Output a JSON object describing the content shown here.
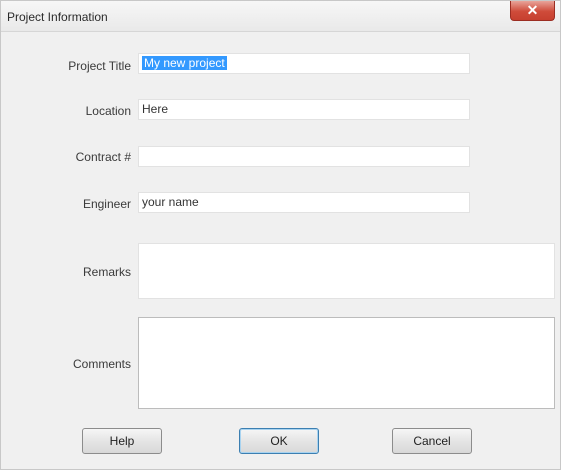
{
  "window": {
    "title": "Project Information",
    "close_glyph": "✕"
  },
  "form": {
    "project_title": {
      "label": "Project Title",
      "value": "My new project"
    },
    "location": {
      "label": "Location",
      "value": "Here"
    },
    "contract": {
      "label": "Contract #",
      "value": ""
    },
    "engineer": {
      "label": "Engineer",
      "value": "your name"
    },
    "remarks": {
      "label": "Remarks",
      "value": ""
    },
    "comments": {
      "label": "Comments",
      "value": ""
    }
  },
  "buttons": {
    "help": "Help",
    "ok": "OK",
    "cancel": "Cancel"
  },
  "colors": {
    "selection": "#3399ff",
    "close_button": "#cf4b3a"
  }
}
